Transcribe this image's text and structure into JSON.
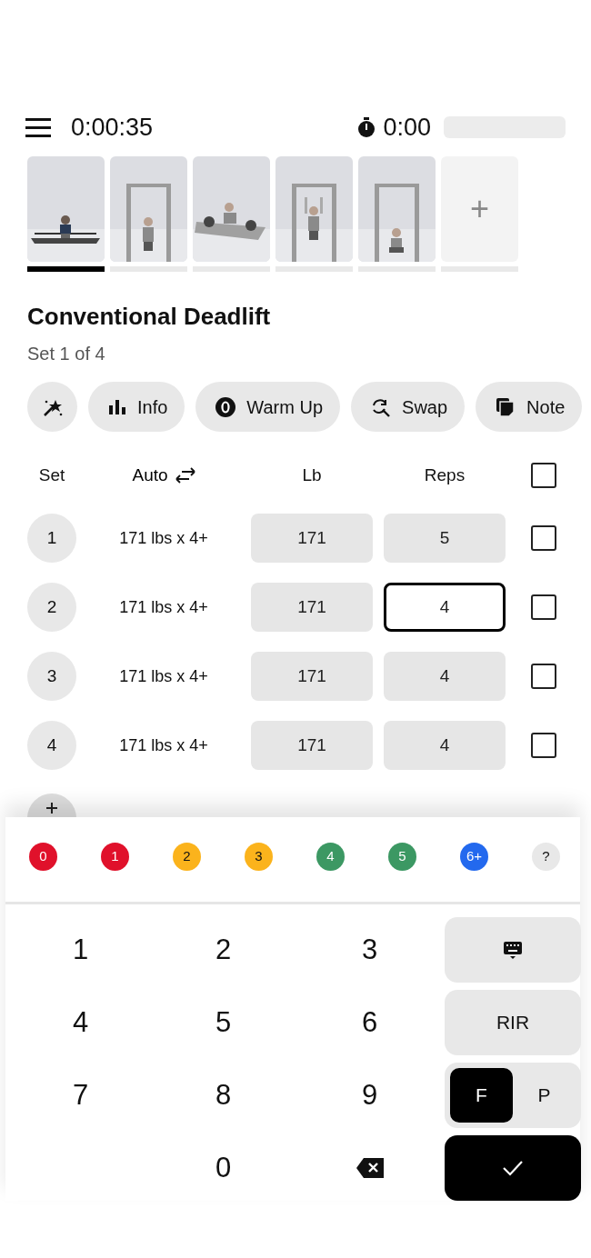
{
  "header": {
    "elapsed": "0:00:35",
    "rest_timer": "0:00"
  },
  "exercises": [
    {
      "kind": "picture",
      "selected": true
    },
    {
      "kind": "picture",
      "selected": false
    },
    {
      "kind": "picture",
      "selected": false
    },
    {
      "kind": "picture",
      "selected": false
    },
    {
      "kind": "picture",
      "selected": false
    },
    {
      "kind": "add",
      "label": "+",
      "selected": false
    }
  ],
  "exercise": {
    "title": "Conventional Deadlift",
    "subtitle": "Set 1 of 4"
  },
  "actions": [
    {
      "kind": "wand"
    },
    {
      "kind": "chart",
      "label": "Info"
    },
    {
      "kind": "warmup",
      "label": "Warm Up"
    },
    {
      "kind": "swap",
      "label": "Swap"
    },
    {
      "kind": "note",
      "label": "Note"
    }
  ],
  "table": {
    "columns": [
      "Set",
      "Auto",
      "Lb",
      "Reps"
    ],
    "all_checked": false,
    "rows": [
      {
        "set": "1",
        "auto": "171 lbs x 4+",
        "lb": "171",
        "reps": "5",
        "focused": false,
        "checked": false
      },
      {
        "set": "2",
        "auto": "171 lbs x 4+",
        "lb": "171",
        "reps": "4",
        "focused": true,
        "checked": false
      },
      {
        "set": "3",
        "auto": "171 lbs x 4+",
        "lb": "171",
        "reps": "4",
        "focused": false,
        "checked": false
      },
      {
        "set": "4",
        "auto": "171 lbs x 4+",
        "lb": "171",
        "reps": "4",
        "focused": false,
        "checked": false
      }
    ]
  },
  "rir_options": [
    {
      "label": "0",
      "color": "#e0112b"
    },
    {
      "label": "1",
      "color": "#e0112b"
    },
    {
      "label": "2",
      "color": "#fbb31c"
    },
    {
      "label": "3",
      "color": "#fbb31c"
    },
    {
      "label": "4",
      "color": "#3c9863"
    },
    {
      "label": "5",
      "color": "#3c9863"
    },
    {
      "label": "6+",
      "color": "#2369ee"
    },
    {
      "label": "?",
      "color": "#e8e8e8"
    }
  ],
  "keypad": {
    "keys": [
      {
        "kind": "digit",
        "label": "1"
      },
      {
        "kind": "digit",
        "label": "2"
      },
      {
        "kind": "digit",
        "label": "3"
      },
      {
        "kind": "digit",
        "label": "4"
      },
      {
        "kind": "digit",
        "label": "5"
      },
      {
        "kind": "digit",
        "label": "6"
      },
      {
        "kind": "digit",
        "label": "7"
      },
      {
        "kind": "digit",
        "label": "8"
      },
      {
        "kind": "digit",
        "label": "9"
      },
      {
        "kind": "blank"
      },
      {
        "kind": "digit",
        "label": "0"
      },
      {
        "kind": "backspace"
      }
    ],
    "side": [
      {
        "kind": "keyboard"
      },
      {
        "kind": "text",
        "label": "RIR"
      },
      {
        "kind": "toggle",
        "options": [
          {
            "label": "F",
            "selected": true
          },
          {
            "label": "P",
            "selected": false
          }
        ]
      },
      {
        "kind": "confirm"
      }
    ]
  }
}
